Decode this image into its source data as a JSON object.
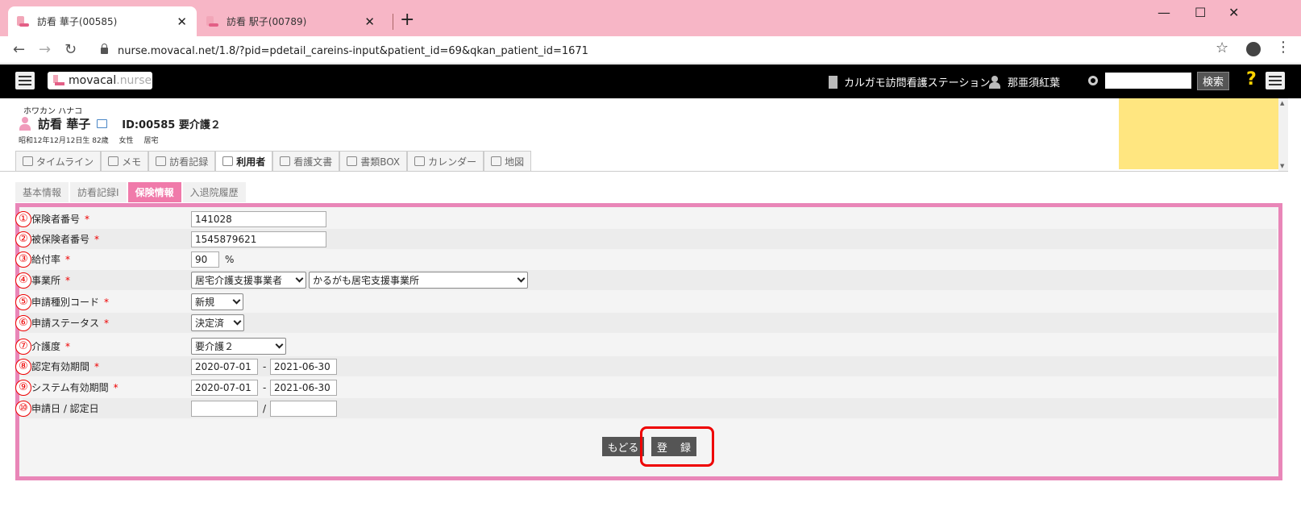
{
  "browser": {
    "tabs": [
      {
        "title": "訪看 華子(00585)",
        "close": "✕"
      },
      {
        "title": "訪看 駅子(00789)",
        "close": "✕"
      }
    ],
    "new_tab": "+",
    "window": {
      "minimize": "—",
      "maximize": "☐",
      "close": "✕"
    },
    "url": "nurse.movacal.net/1.8/?pid=pdetail_careins-input&patient_id=69&qkan_patient_id=1671"
  },
  "app": {
    "logo": {
      "brand": "movacal",
      "sub": "nurse"
    },
    "station": "カルガモ訪問看護ステーション",
    "user": "那亜須紅葉",
    "search_button": "検索",
    "help": "?"
  },
  "patient": {
    "kana": "ホワカン ハナコ",
    "name": "訪看 華子",
    "id_label": "ID:00585 要介護２",
    "birth": "昭和12年12月12日生 82歳",
    "gender": "女性",
    "residence": "居宅"
  },
  "main_tabs": [
    "タイムライン",
    "メモ",
    "訪看記録",
    "利用者",
    "看護文書",
    "書類BOX",
    "カレンダー",
    "地図"
  ],
  "sub_tabs": [
    "基本情報",
    "訪看記録I",
    "保険情報",
    "入退院履歴"
  ],
  "form": {
    "rows": [
      {
        "num": "①",
        "label": "保険者番号"
      },
      {
        "num": "②",
        "label": "被保険者番号"
      },
      {
        "num": "③",
        "label": "給付率"
      },
      {
        "num": "④",
        "label": "事業所"
      },
      {
        "num": "⑤",
        "label": "申請種別コード"
      },
      {
        "num": "⑥",
        "label": "申請ステータス"
      },
      {
        "num": "⑦",
        "label": "介護度"
      },
      {
        "num": "⑧",
        "label": "認定有効期間"
      },
      {
        "num": "⑨",
        "label": "システム有効期間"
      },
      {
        "num": "⑩",
        "label": "申請日 / 認定日"
      }
    ],
    "required_mark": "*",
    "insurer_number": "141028",
    "insured_number": "1545879621",
    "benefit_rate": "90",
    "percent": "%",
    "office_type": "居宅介護支援事業者",
    "office_name": "かるがも居宅支援事業所",
    "application_type": "新規",
    "application_status": "決定済",
    "care_level": "要介護２",
    "cert_start": "2020-07-01",
    "cert_end": "2021-06-30",
    "sys_start": "2020-07-01",
    "sys_end": "2021-06-30",
    "range_sep": "-",
    "date_sep": "/",
    "back_button": "もどる",
    "register_button": "登 録"
  }
}
